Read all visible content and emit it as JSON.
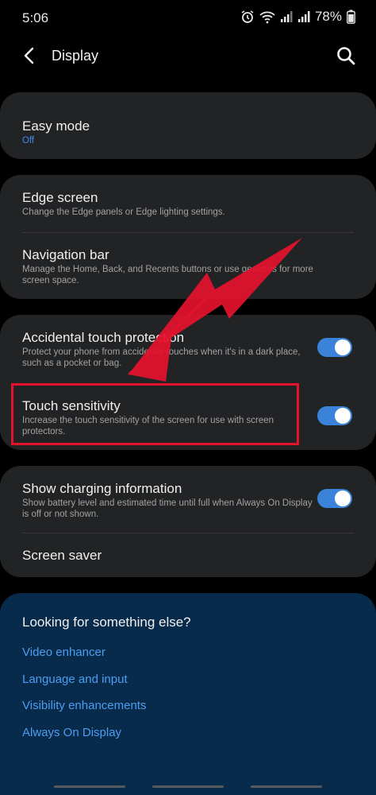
{
  "status_bar": {
    "time": "5:06",
    "battery": "78%",
    "icons": [
      "alarm-icon",
      "wifi-icon",
      "signal-icon",
      "battery-icon"
    ]
  },
  "header": {
    "title": "Display",
    "back_icon": "chevron-left-icon",
    "search_icon": "search-icon"
  },
  "cards": {
    "easy_mode": {
      "title": "Easy mode",
      "value": "Off"
    },
    "edge_screen": {
      "title": "Edge screen",
      "subtitle": "Change the Edge panels or Edge lighting settings."
    },
    "navigation_bar": {
      "title": "Navigation bar",
      "subtitle": "Manage the Home, Back, and Recents buttons or use gestures for more screen space."
    },
    "accidental_touch": {
      "title": "Accidental touch protection",
      "subtitle": "Protect your phone from accidental touches when it's in a dark place, such as a pocket or bag.",
      "enabled": true
    },
    "touch_sensitivity": {
      "title": "Touch sensitivity",
      "subtitle": "Increase the touch sensitivity of the screen for use with screen protectors.",
      "enabled": true
    },
    "charging_info": {
      "title": "Show charging information",
      "subtitle": "Show battery level and estimated time until full when Always On Display is off or not shown.",
      "enabled": true
    },
    "screen_saver": {
      "title": "Screen saver"
    }
  },
  "suggestions": {
    "title": "Looking for something else?",
    "links": [
      "Video enhancer",
      "Language and input",
      "Visibility enhancements",
      "Always On Display"
    ]
  },
  "colors": {
    "background": "#000000",
    "card": "#222325",
    "accent": "#3a83d9",
    "link": "#4c9ef2",
    "suggest_card": "#082a4b",
    "annotation": "#e4122d"
  }
}
